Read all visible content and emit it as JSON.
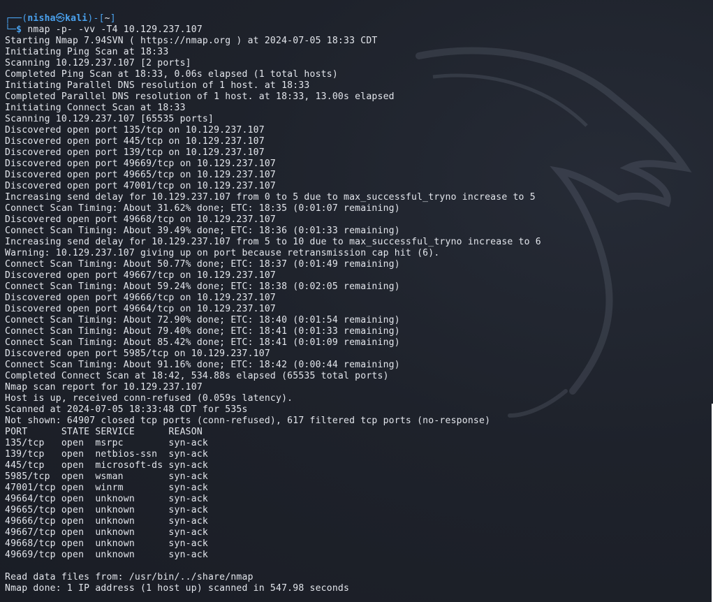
{
  "prompt": {
    "corner_top": "┌──(",
    "user": "nisha",
    "at_symbol": "㉿",
    "host": "kali",
    "after_host": ")-[",
    "path": "~",
    "close_bracket": "]",
    "corner_bottom": "└─",
    "dollar": "$ ",
    "command": "nmap -p- -vv -T4 10.129.237.107"
  },
  "output_lines": [
    "Starting Nmap 7.94SVN ( https://nmap.org ) at 2024-07-05 18:33 CDT",
    "Initiating Ping Scan at 18:33",
    "Scanning 10.129.237.107 [2 ports]",
    "Completed Ping Scan at 18:33, 0.06s elapsed (1 total hosts)",
    "Initiating Parallel DNS resolution of 1 host. at 18:33",
    "Completed Parallel DNS resolution of 1 host. at 18:33, 13.00s elapsed",
    "Initiating Connect Scan at 18:33",
    "Scanning 10.129.237.107 [65535 ports]",
    "Discovered open port 135/tcp on 10.129.237.107",
    "Discovered open port 445/tcp on 10.129.237.107",
    "Discovered open port 139/tcp on 10.129.237.107",
    "Discovered open port 49669/tcp on 10.129.237.107",
    "Discovered open port 49665/tcp on 10.129.237.107",
    "Discovered open port 47001/tcp on 10.129.237.107",
    "Increasing send delay for 10.129.237.107 from 0 to 5 due to max_successful_tryno increase to 5",
    "Connect Scan Timing: About 31.62% done; ETC: 18:35 (0:01:07 remaining)",
    "Discovered open port 49668/tcp on 10.129.237.107",
    "Connect Scan Timing: About 39.49% done; ETC: 18:36 (0:01:33 remaining)",
    "Increasing send delay for 10.129.237.107 from 5 to 10 due to max_successful_tryno increase to 6",
    "Warning: 10.129.237.107 giving up on port because retransmission cap hit (6).",
    "Connect Scan Timing: About 50.77% done; ETC: 18:37 (0:01:49 remaining)",
    "Discovered open port 49667/tcp on 10.129.237.107",
    "Connect Scan Timing: About 59.24% done; ETC: 18:38 (0:02:05 remaining)",
    "Discovered open port 49666/tcp on 10.129.237.107",
    "Discovered open port 49664/tcp on 10.129.237.107",
    "Connect Scan Timing: About 72.90% done; ETC: 18:40 (0:01:54 remaining)",
    "Connect Scan Timing: About 79.40% done; ETC: 18:41 (0:01:33 remaining)",
    "Connect Scan Timing: About 85.42% done; ETC: 18:41 (0:01:09 remaining)",
    "Discovered open port 5985/tcp on 10.129.237.107",
    "Connect Scan Timing: About 91.16% done; ETC: 18:42 (0:00:44 remaining)",
    "Completed Connect Scan at 18:42, 534.88s elapsed (65535 total ports)",
    "Nmap scan report for 10.129.237.107",
    "Host is up, received conn-refused (0.059s latency).",
    "Scanned at 2024-07-05 18:33:48 CDT for 535s",
    "Not shown: 64907 closed tcp ports (conn-refused), 617 filtered tcp ports (no-response)",
    "PORT      STATE SERVICE      REASON",
    "135/tcp   open  msrpc        syn-ack",
    "139/tcp   open  netbios-ssn  syn-ack",
    "445/tcp   open  microsoft-ds syn-ack",
    "5985/tcp  open  wsman        syn-ack",
    "47001/tcp open  winrm        syn-ack",
    "49664/tcp open  unknown      syn-ack",
    "49665/tcp open  unknown      syn-ack",
    "49666/tcp open  unknown      syn-ack",
    "49667/tcp open  unknown      syn-ack",
    "49668/tcp open  unknown      syn-ack",
    "49669/tcp open  unknown      syn-ack",
    "",
    "Read data files from: /usr/bin/../share/nmap",
    "Nmap done: 1 IP address (1 host up) scanned in 547.98 seconds"
  ],
  "colors": {
    "background": "#1c2028",
    "text": "#e3e6ec",
    "prompt_accent": "#4aa3f0"
  },
  "icons": {
    "background_logo": "kali-dragon-icon"
  }
}
